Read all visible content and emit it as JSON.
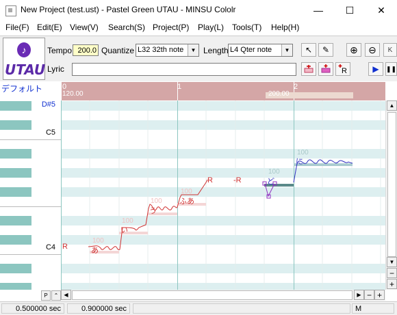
{
  "window": {
    "title": "New Project (test.ust) - Pastel Green UTAU - MINSU Cololr",
    "minimize_glyph": "—",
    "maximize_glyph": "☐",
    "close_glyph": "✕"
  },
  "menu": [
    "File(F)",
    "Edit(E)",
    "View(V)",
    "Search(S)",
    "Project(P)",
    "Play(L)",
    "Tools(T)",
    "Help(H)"
  ],
  "logo_text": "UTAU",
  "toolbar": {
    "tempo_label": "Tempo",
    "tempo_value": "200.0",
    "quantize_label": "Quantize",
    "quantize_value": "L32 32th note",
    "length_label": "Length",
    "length_value": "L4  Qter note",
    "lyric_label": "Lyric",
    "lyric_value": "",
    "buttons": {
      "select": "↖",
      "pencil": "✎",
      "zoom_in": "⊕",
      "zoom_out": "⊖",
      "play": "▶",
      "stop": "❚❚"
    }
  },
  "track": {
    "name": "デフォルト"
  },
  "ruler": {
    "measures": [
      "0",
      "1",
      "2"
    ],
    "tempo_mark": "120.00",
    "tempo_mark2": "200.00"
  },
  "piano": {
    "labels": [
      "D#5",
      "C5",
      "C4"
    ]
  },
  "notes": [
    {
      "lyric": "R",
      "tag": ""
    },
    {
      "lyric": "あ",
      "tag": "100"
    },
    {
      "lyric": "い",
      "tag": "100"
    },
    {
      "lyric": "う",
      "tag": "100"
    },
    {
      "lyric": "ふあ",
      "tag": "100"
    },
    {
      "lyric": "R",
      "tag": ""
    },
    {
      "lyric": "-R",
      "tag": ""
    },
    {
      "lyric": "ど",
      "tag": "100"
    },
    {
      "lyric": "に",
      "tag": "100"
    }
  ],
  "bottom": {
    "p_label": "P",
    "m_label": "M",
    "plus": "+",
    "minus": "−",
    "status_left": "0.500000 sec",
    "status_right": "0.900000 sec"
  },
  "colors": {
    "accent_purple": "#6a2bb5",
    "ruler": "#d4a6a6",
    "black_key": "#8cc6c0",
    "pitch_red": "#d03030",
    "pitch_blue": "#3030c0"
  }
}
